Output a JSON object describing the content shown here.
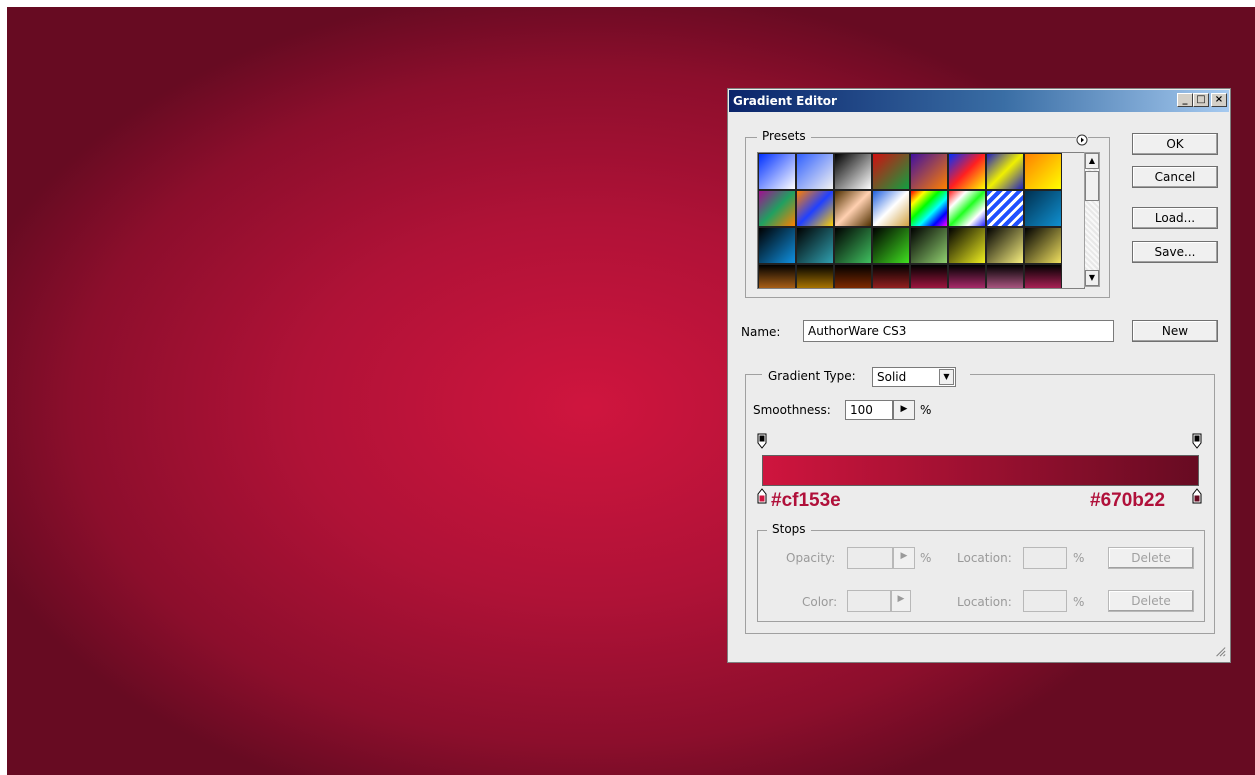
{
  "window": {
    "title": "Gradient Editor",
    "title_buttons": {
      "minimize": "_",
      "maximize": "□",
      "close": "×"
    }
  },
  "presets": {
    "legend": "Presets",
    "menu_icon": "flyout-menu-icon",
    "swatches": [
      "linear-gradient(135deg,#0030ff,#ffffff)",
      "linear-gradient(135deg,#3060ff,rgba(255,255,255,0.3))",
      "linear-gradient(135deg,#000,#fff)",
      "linear-gradient(135deg,#d01010,#10a040)",
      "linear-gradient(135deg,#4010a0,#ff8000)",
      "linear-gradient(135deg,#0030ff,#ff2020,#ffff00)",
      "linear-gradient(135deg,#2020c0,#f0f000,#2020c0)",
      "linear-gradient(135deg,#ff8000,#ffff00)",
      "linear-gradient(135deg,#a01090,#20a060,#ff8000)",
      "linear-gradient(135deg,#ff8000,#2040ff,#ffd000)",
      "linear-gradient(135deg,#503000,#ffd0b0,#503000)",
      "linear-gradient(135deg,#2060e0,#ffffff,#d0a040)",
      "linear-gradient(135deg,#ff0000,#ffff00,#00ff00,#00ffff,#0000ff,#ff00ff)",
      "linear-gradient(135deg,#ff2020,#ffffff,#20ff20,#ffffff,#2020ff)",
      "repeating-linear-gradient(135deg,#2050ff 0 4px,#ffffff 4px 7px)",
      "linear-gradient(135deg,#003050,#1090d0)",
      "linear-gradient(135deg,#000,#1090e0)",
      "linear-gradient(135deg,#000,#30a0b0)",
      "linear-gradient(135deg,#000,#40c060)",
      "linear-gradient(135deg,#000,#40e020)",
      "linear-gradient(135deg,#000,#90d070)",
      "linear-gradient(135deg,#000,#f0f020)",
      "linear-gradient(135deg,#000,#f8f080)",
      "linear-gradient(135deg,#000,#f0e060)",
      "linear-gradient(180deg,#000,#ff9020)",
      "linear-gradient(180deg,#000,#ffb000)",
      "linear-gradient(180deg,#000,#c04000)",
      "linear-gradient(180deg,#000,#e03030)",
      "linear-gradient(180deg,#000,#f02060)",
      "linear-gradient(180deg,#000,#ff40a0)",
      "linear-gradient(180deg,#000,#ff80c0)",
      "linear-gradient(180deg,#000,#ff3080)"
    ]
  },
  "buttons": {
    "ok": "OK",
    "cancel": "Cancel",
    "load": "Load...",
    "save": "Save...",
    "new": "New"
  },
  "name_field": {
    "label": "Name:",
    "value": "AuthorWare CS3"
  },
  "gradient": {
    "type_label": "Gradient Type:",
    "type_value": "Solid",
    "smoothness_label": "Smoothness:",
    "smoothness_value": "100",
    "smoothness_unit": "%",
    "start_color": "#cf153e",
    "end_color": "#670b22",
    "start_label": "#cf153e",
    "end_label": "#670b22"
  },
  "stops": {
    "legend": "Stops",
    "opacity_label": "Opacity:",
    "opacity_unit": "%",
    "location_label_1": "Location:",
    "location_unit_1": "%",
    "delete_1": "Delete",
    "color_label": "Color:",
    "location_label_2": "Location:",
    "location_unit_2": "%",
    "delete_2": "Delete"
  }
}
